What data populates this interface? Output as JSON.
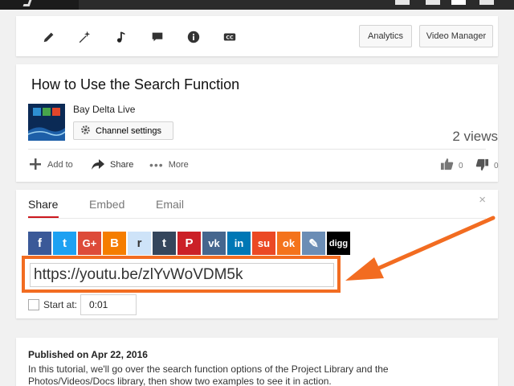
{
  "toolbar": {
    "icons": [
      "pencil-icon",
      "magic-wand-icon",
      "music-note-icon",
      "comment-icon",
      "info-icon",
      "cc-icon"
    ],
    "analytics_label": "Analytics",
    "video_manager_label": "Video Manager"
  },
  "video": {
    "title": "How to Use the Search Function",
    "channel_name": "Bay Delta Live",
    "channel_settings_label": "Channel settings",
    "views": "2 views",
    "actions": {
      "add_to": "Add to",
      "share": "Share",
      "more": "More"
    },
    "likes": "0",
    "dislikes": "0"
  },
  "share": {
    "tabs": [
      "Share",
      "Embed",
      "Email"
    ],
    "active_tab": "Share",
    "close": "×",
    "social": [
      {
        "name": "facebook",
        "glyph": "f",
        "color": "#3b5998"
      },
      {
        "name": "twitter",
        "glyph": "t",
        "color": "#1da1f2"
      },
      {
        "name": "google-plus",
        "glyph": "G+",
        "color": "#dd4b39"
      },
      {
        "name": "blogger",
        "glyph": "B",
        "color": "#f57d00"
      },
      {
        "name": "reddit",
        "glyph": "r",
        "color": "#cee3f8"
      },
      {
        "name": "tumblr",
        "glyph": "t",
        "color": "#35465c"
      },
      {
        "name": "pinterest",
        "glyph": "P",
        "color": "#cb2027"
      },
      {
        "name": "vk",
        "glyph": "vk",
        "color": "#45668e"
      },
      {
        "name": "linkedin",
        "glyph": "in",
        "color": "#0077b5"
      },
      {
        "name": "stumbleupon",
        "glyph": "su",
        "color": "#eb4924"
      },
      {
        "name": "odnoklassniki",
        "glyph": "ok",
        "color": "#f4731c"
      },
      {
        "name": "livejournal",
        "glyph": "✎",
        "color": "#6b8db5"
      },
      {
        "name": "digg",
        "glyph": "digg",
        "color": "#000000"
      }
    ],
    "url": "https://youtu.be/zlYvWoVDM5k",
    "start_at_label": "Start at:",
    "start_at_value": "0:01"
  },
  "description": {
    "published": "Published on Apr 22, 2016",
    "line1": "In this tutorial, we'll go over the search function options of the Project Library and the",
    "line2": "Photos/Videos/Docs library, then show two examples to see it in action."
  },
  "colors": {
    "accent_red": "#cc181e",
    "highlight_orange": "#f26c21"
  }
}
